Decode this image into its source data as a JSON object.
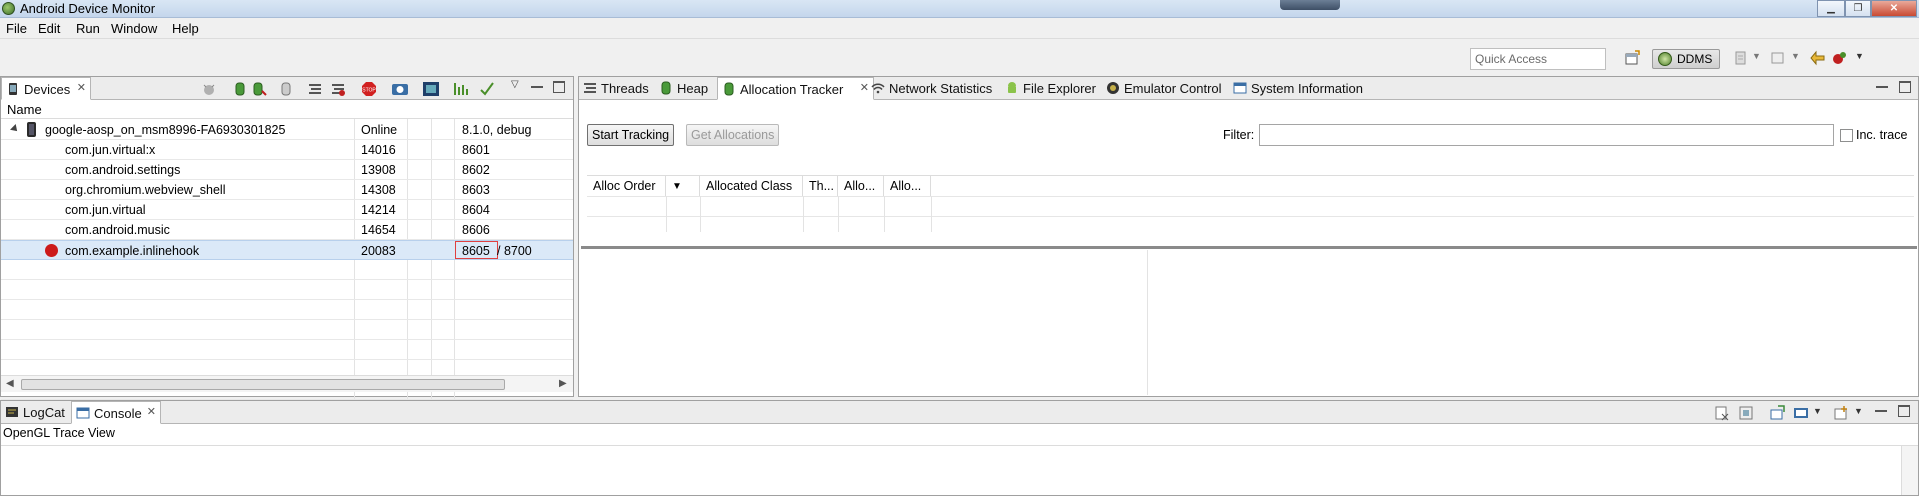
{
  "window": {
    "title": "Android Device Monitor"
  },
  "menu": [
    "File",
    "Edit",
    "Run",
    "Window",
    "Help"
  ],
  "toolbar": {
    "quick_access_placeholder": "Quick Access",
    "perspective_label": "DDMS"
  },
  "devices_panel": {
    "tab_label": "Devices",
    "column_header": "Name",
    "device": {
      "name": "google-aosp_on_msm8996-FA6930301825",
      "status": "Online",
      "version": "8.1.0, debug"
    },
    "processes": [
      {
        "name": "com.jun.virtual:x",
        "pid": "14016",
        "port": "8601"
      },
      {
        "name": "com.android.settings",
        "pid": "13908",
        "port": "8602"
      },
      {
        "name": "org.chromium.webview_shell",
        "pid": "14308",
        "port": "8603"
      },
      {
        "name": "com.jun.virtual",
        "pid": "14214",
        "port": "8604"
      },
      {
        "name": "com.android.music",
        "pid": "14654",
        "port": "8606"
      },
      {
        "name": "com.example.inlinehook",
        "pid": "20083",
        "port": "8605",
        "debug_port": "/ 8700"
      }
    ]
  },
  "right_tabs": [
    "Threads",
    "Heap",
    "Allocation Tracker",
    "Network Statistics",
    "File Explorer",
    "Emulator Control",
    "System Information"
  ],
  "allocation": {
    "start_button": "Start Tracking",
    "get_button": "Get Allocations",
    "filter_label": "Filter:",
    "filter_value": "",
    "inc_trace_label": "Inc. trace",
    "columns": [
      "Alloc Order",
      "▼",
      "Allocated Class",
      "Th...",
      "Allo...",
      "Allo..."
    ]
  },
  "bottom_panel": {
    "tabs": [
      "LogCat",
      "Console"
    ],
    "text": "OpenGL Trace View"
  },
  "colors": {
    "selection": "#dbe9f8",
    "highlight_box": "#e04040",
    "debug_bug": "#cc1a1a"
  }
}
